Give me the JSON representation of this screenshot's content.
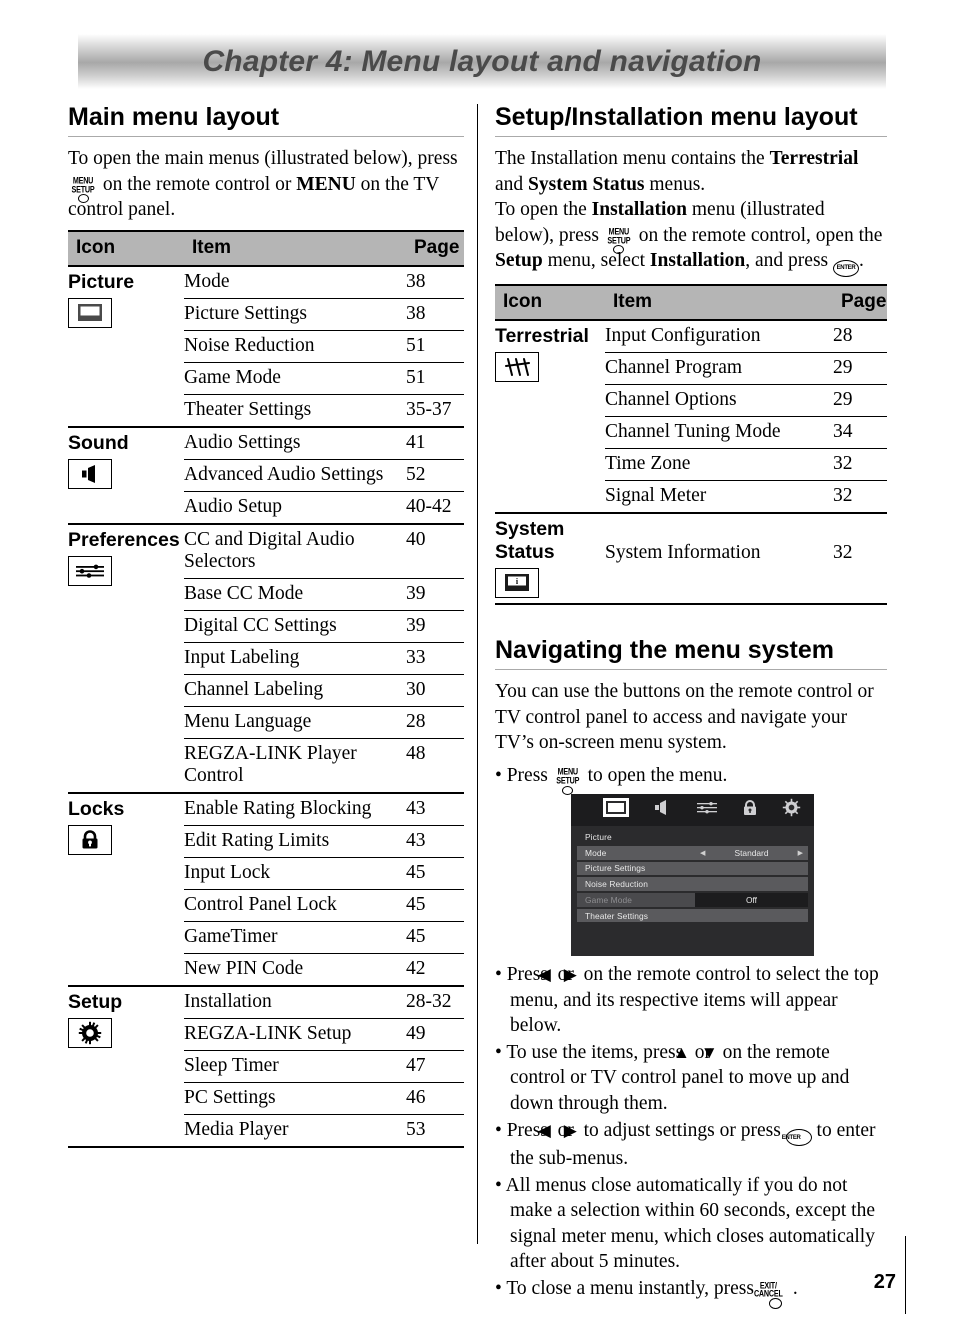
{
  "banner": {
    "title": "Chapter 4: Menu layout and navigation"
  },
  "page_number": "27",
  "left": {
    "heading": "Main menu layout",
    "intro": {
      "part1": "To open the main menus (illustrated below), press",
      "part2": "on the remote control or",
      "menu_bold": "MENU",
      "part3": "on the TV control panel."
    },
    "table": {
      "headers": {
        "icon": "Icon",
        "item": "Item",
        "page": "Page"
      },
      "groups": [
        {
          "category": "Picture",
          "icon": "tv-screen-icon",
          "rows": [
            {
              "item": "Mode",
              "page": "38"
            },
            {
              "item": "Picture Settings",
              "page": "38"
            },
            {
              "item": "Noise Reduction",
              "page": "51"
            },
            {
              "item": "Game Mode",
              "page": "51"
            },
            {
              "item": "Theater Settings",
              "page": "35-37"
            }
          ]
        },
        {
          "category": "Sound",
          "icon": "speaker-icon",
          "rows": [
            {
              "item": "Audio Settings",
              "page": "41"
            },
            {
              "item": "Advanced Audio Settings",
              "page": "52"
            },
            {
              "item": "Audio Setup",
              "page": "40-42"
            }
          ]
        },
        {
          "category": "Preferences",
          "icon": "sliders-icon",
          "rows": [
            {
              "item": "CC and Digital Audio Selectors",
              "page": "40"
            },
            {
              "item": "Base CC Mode",
              "page": "39"
            },
            {
              "item": "Digital CC Settings",
              "page": "39"
            },
            {
              "item": "Input Labeling",
              "page": "33"
            },
            {
              "item": "Channel Labeling",
              "page": "30"
            },
            {
              "item": "Menu Language",
              "page": "28"
            },
            {
              "item": "REGZA-LINK Player Control",
              "page": "48"
            }
          ]
        },
        {
          "category": "Locks",
          "icon": "lock-icon",
          "rows": [
            {
              "item": "Enable Rating Blocking",
              "page": "43"
            },
            {
              "item": "Edit Rating Limits",
              "page": "43"
            },
            {
              "item": "Input Lock",
              "page": "45"
            },
            {
              "item": "Control Panel Lock",
              "page": "45"
            },
            {
              "item": "GameTimer",
              "page": "45"
            },
            {
              "item": "New PIN Code",
              "page": "42"
            }
          ]
        },
        {
          "category": "Setup",
          "icon": "gear-icon",
          "rows": [
            {
              "item": "Installation",
              "page": "28-32"
            },
            {
              "item": "REGZA-LINK Setup",
              "page": "49"
            },
            {
              "item": "Sleep Timer",
              "page": "47"
            },
            {
              "item": "PC Settings",
              "page": "46"
            },
            {
              "item": "Media Player",
              "page": "53"
            }
          ]
        }
      ]
    }
  },
  "right": {
    "heading": "Setup/Installation menu layout",
    "intro": {
      "s1a": "The Installation menu contains the",
      "s1b": "Terrestrial",
      "s1c": "and",
      "s1d": "System Status",
      "s1e": "menus.",
      "s2a": "To open the",
      "s2b": "Installation",
      "s2c": "menu (illustrated below), press",
      "s2d": "on the remote control, open the",
      "s3a": "Setup",
      "s3b": "menu, select",
      "s3c": "Installation",
      "s3d": ", and press",
      "s3e": "."
    },
    "table": {
      "headers": {
        "icon": "Icon",
        "item": "Item",
        "page": "Page"
      },
      "groups": [
        {
          "category": "Terrestrial",
          "icon": "antenna-icon",
          "rows": [
            {
              "item": "Input Configuration",
              "page": "28"
            },
            {
              "item": "Channel Program",
              "page": "29"
            },
            {
              "item": "Channel Options",
              "page": "29"
            },
            {
              "item": "Channel Tuning Mode",
              "page": "34"
            },
            {
              "item": "Time Zone",
              "page": "32"
            },
            {
              "item": "Signal Meter",
              "page": "32"
            }
          ]
        },
        {
          "category": "System Status",
          "icon": "information-screen-icon",
          "rows": [
            {
              "item": "System Information",
              "page": "32"
            }
          ]
        }
      ]
    },
    "nav": {
      "heading": "Navigating the menu system",
      "intro": "You can use the buttons on the remote control or TV control panel to access and navigate your TV’s on-screen menu system.",
      "bullet_open_a": "Press",
      "bullet_open_b": "to open the menu.",
      "bullets": [
        {
          "a": "Press",
          "left": "◀",
          "mid": "or",
          "right": "▶",
          "b": "on the remote control to select the top menu, and its respective items will appear below."
        },
        {
          "a": "To use the items, press",
          "left": "▲",
          "mid": "or",
          "right": "▼",
          "b": "on the remote control or TV control panel to move up and down through them."
        }
      ],
      "bullet_adjust_a": "Press",
      "bullet_adjust_left": "◀",
      "bullet_adjust_mid": "or",
      "bullet_adjust_right": "▶",
      "bullet_adjust_b": "to adjust settings or press",
      "bullet_adjust_c": "to enter the sub-menus.",
      "bullet_timeout": "All menus close automatically if you do not make a selection within 60 seconds, except the signal meter menu, which closes automatically after about 5 minutes.",
      "bullet_close_a": "To close a menu instantly, press",
      "bullet_close_b": "."
    },
    "osd": {
      "icons": [
        "tv-screen-icon",
        "speaker-icon",
        "sliders-icon",
        "lock-icon",
        "gear-icon"
      ],
      "title": "Picture",
      "rows": [
        {
          "label": "Mode",
          "value": "Standard",
          "arrows": true,
          "dim": false,
          "boxed": false
        },
        {
          "label": "Picture Settings",
          "value": "",
          "arrows": false,
          "dim": false,
          "boxed": false
        },
        {
          "label": "Noise Reduction",
          "value": "",
          "arrows": false,
          "dim": false,
          "boxed": false
        },
        {
          "label": "Game Mode",
          "value": "Off",
          "arrows": false,
          "dim": true,
          "boxed": true
        },
        {
          "label": "Theater Settings",
          "value": "",
          "arrows": false,
          "dim": false,
          "boxed": false
        }
      ]
    }
  },
  "glyphs": {
    "menu_l1": "MENU",
    "menu_l2": "SETUP",
    "enter": "ENTER",
    "exit_l1": "EXIT/",
    "exit_l2": "CANCEL"
  }
}
